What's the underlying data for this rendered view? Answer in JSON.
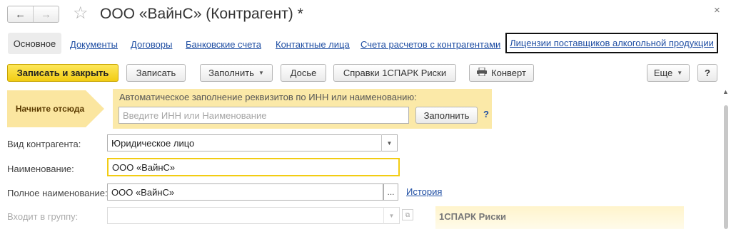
{
  "window": {
    "title": "ООО «ВайнС» (Контрагент) *",
    "back_icon": "←",
    "forward_icon": "→",
    "star_icon": "☆",
    "close_icon": "×"
  },
  "tabs": {
    "active": "Основное",
    "links": [
      "Документы",
      "Договоры",
      "Банковские счета",
      "Контактные лица",
      "Счета расчетов с контрагентами"
    ],
    "selected": "Лицензии поставщиков алкогольной продукции"
  },
  "toolbar": {
    "save_close": "Записать и закрыть",
    "save": "Записать",
    "fill": "Заполнить",
    "dossier": "Досье",
    "spark": "Справки 1СПАРК Риски",
    "envelope": "Конверт",
    "more": "Еще",
    "help": "?"
  },
  "autofill": {
    "start_label": "Начните отсюда",
    "caption": "Автоматическое заполнение реквизитов по ИНН или наименованию:",
    "placeholder": "Введите ИНН или Наименование",
    "button": "Заполнить",
    "help": "?"
  },
  "form": {
    "kind_label": "Вид контрагента:",
    "kind_value": "Юридическое лицо",
    "name_label": "Наименование:",
    "name_value": "ООО «ВайнС»",
    "fullname_label": "Полное наименование:",
    "fullname_value": "ООО «ВайнС»",
    "history_link": "История",
    "group_label": "Входит в группу:",
    "dots": "...",
    "spark_panel_title": "1СПАРК Риски"
  },
  "colors": {
    "accent_yellow": "#f2cc13",
    "panel_yellow": "#fbe9a8",
    "link_blue": "#1f4ea3"
  }
}
